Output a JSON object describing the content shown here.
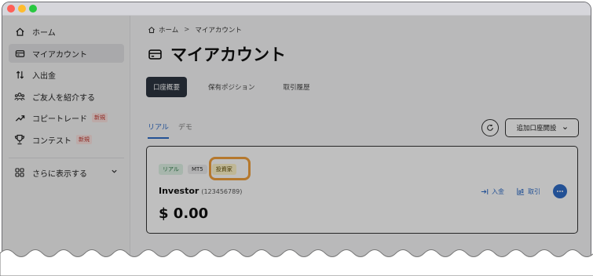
{
  "sidebar": {
    "items": [
      {
        "label": "ホーム",
        "icon": "home-icon"
      },
      {
        "label": "マイアカウント",
        "icon": "wallet-icon"
      },
      {
        "label": "入出金",
        "icon": "transfer-arrows-icon"
      },
      {
        "label": "ご友人を紹介する",
        "icon": "people-icon"
      },
      {
        "label": "コピートレード",
        "icon": "trend-arrow-icon",
        "badge": "新規"
      },
      {
        "label": "コンテスト",
        "icon": "trophy-icon",
        "badge": "新規"
      }
    ],
    "more": {
      "label": "さらに表示する",
      "icon": "grid-icon"
    }
  },
  "breadcrumb": {
    "home": "ホーム",
    "separator": ">",
    "current": "マイアカウント"
  },
  "page_title": "マイアカウント",
  "tabs": [
    "口座概要",
    "保有ポジション",
    "取引履歴"
  ],
  "subtabs": [
    "リアル",
    "デモ"
  ],
  "actions": {
    "open_account": "追加口座開設"
  },
  "account": {
    "tags": [
      "リアル",
      "MT5",
      "投資家"
    ],
    "name": "Investor",
    "number": "(123456789)",
    "balance": "$ 0.00",
    "deposit": "入金",
    "trade": "取引"
  },
  "colors": {
    "accent": "#2f6cc7",
    "highlight": "#f2a03c",
    "tab_active": "#2d3540"
  }
}
